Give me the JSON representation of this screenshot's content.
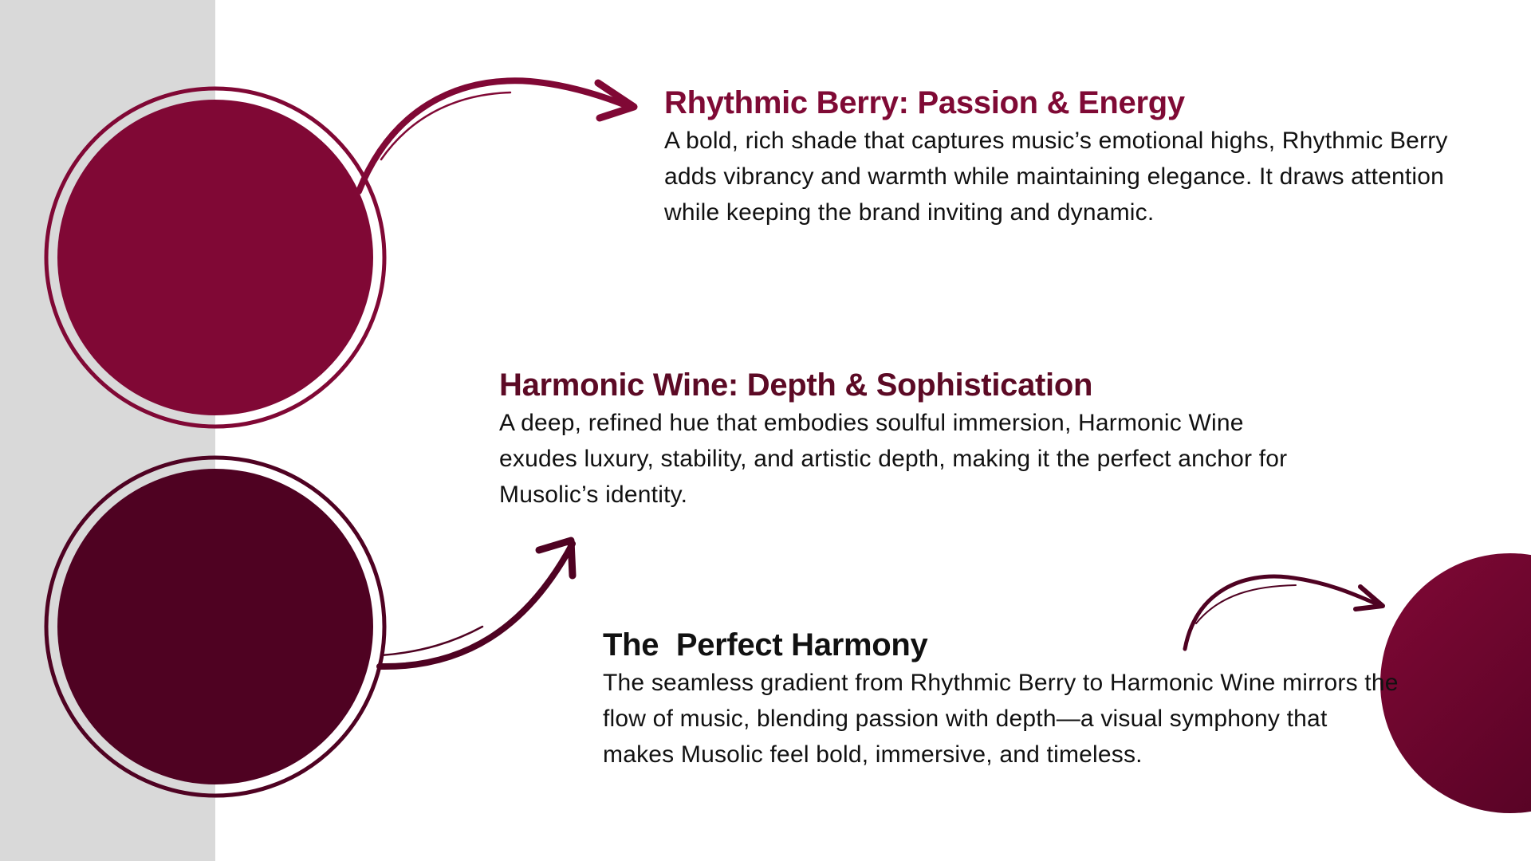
{
  "colors": {
    "rhythmic_berry": "#800835",
    "harmonic_wine": "#4f0222",
    "side_panel": "#d9d9d9",
    "background": "#ffffff",
    "body_text": "#111111"
  },
  "sections": {
    "rhythmic_berry": {
      "heading": "Rhythmic Berry: Passion & Energy",
      "body": "A bold, rich shade that captures music’s emotional highs, Rhythmic Berry adds vibrancy and warmth while maintaining elegance. It draws attention while keeping the brand inviting and dynamic."
    },
    "harmonic_wine": {
      "heading": "Harmonic Wine: Depth & Sophistication",
      "body": "A deep, refined hue that embodies soulful immersion, Harmonic Wine exudes luxury, stability, and artistic depth, making it the perfect anchor for Musolic’s identity."
    },
    "perfect_harmony": {
      "heading": "The  Perfect Harmony",
      "body": "The seamless gradient from Rhythmic Berry to Harmonic Wine mirrors the flow of music, blending passion with depth—a visual symphony that makes Musolic feel bold, immersive, and timeless."
    }
  },
  "icons": {
    "arrow_berry": "curved-arrow-right-icon",
    "arrow_wine": "curved-arrow-up-icon",
    "arrow_harmony": "curved-arrow-right-icon"
  }
}
